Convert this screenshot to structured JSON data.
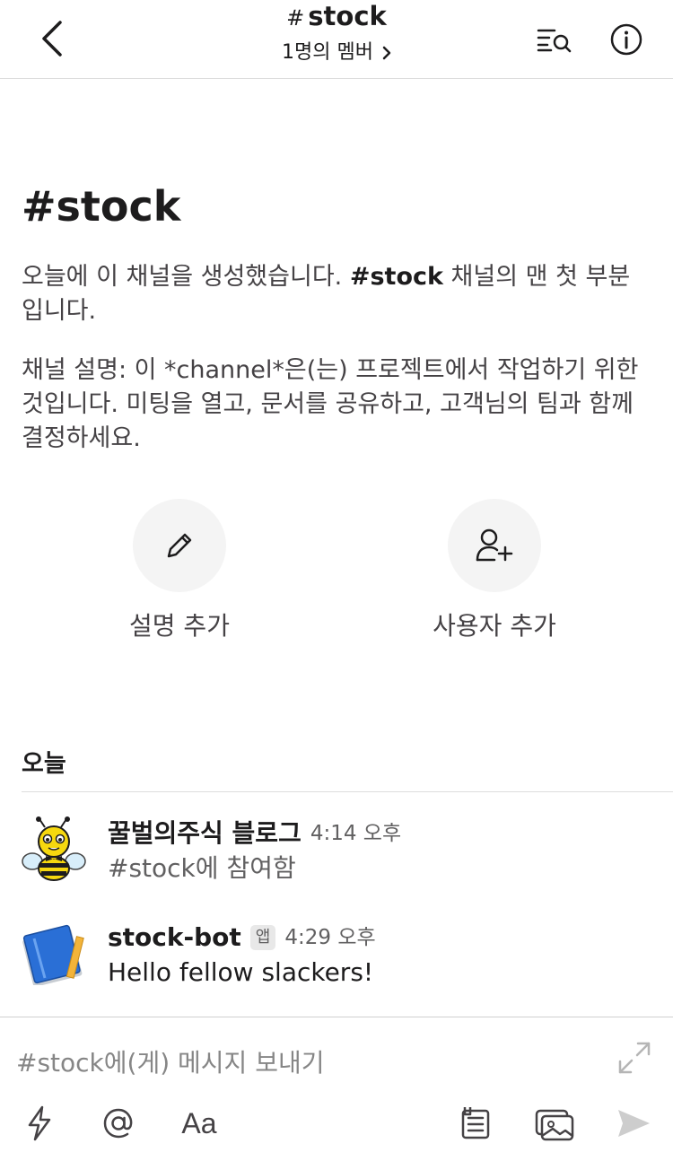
{
  "header": {
    "hash": "#",
    "channel": "stock",
    "members": "1명의 멤버"
  },
  "intro": {
    "title": "#stock",
    "line_prefix": "오늘에 이 채널을 생성했습니다. ",
    "line_channel": "#stock",
    "line_suffix": " 채널의 맨 첫 부분입니다.",
    "description": "채널 설명: 이 *channel*은(는) 프로젝트에서 작업하기 위한 것입니다. 미팅을 열고, 문서를 공유하고, 고객님의 팀과 함께 결정하세요."
  },
  "actions": {
    "add_description": "설명 추가",
    "add_user": "사용자 추가"
  },
  "day_label": "오늘",
  "messages": [
    {
      "sender": "꿀벌의주식 블로그",
      "time": "4:14 오후",
      "text": "#stock에 참여함"
    },
    {
      "sender": "stock-bot",
      "badge": "앱",
      "time": "4:29 오후",
      "text": "Hello fellow slackers!"
    }
  ],
  "composer": {
    "placeholder": "#stock에(게) 메시지 보내기",
    "format_label": "Aa"
  },
  "icons": {
    "back": "chevron-left-icon",
    "search": "search-in-channel-icon",
    "info": "info-icon",
    "edit": "pencil-icon",
    "add_user": "add-user-icon",
    "expand": "expand-icon",
    "shortcuts": "lightning-icon",
    "mention": "at-icon",
    "file": "file-icon",
    "photo": "photo-icon",
    "send": "send-icon"
  },
  "colors": {
    "text": "#1d1c1d",
    "muted": "#616061",
    "circle_bg": "#f4f4f4",
    "divider": "#dddddd"
  }
}
